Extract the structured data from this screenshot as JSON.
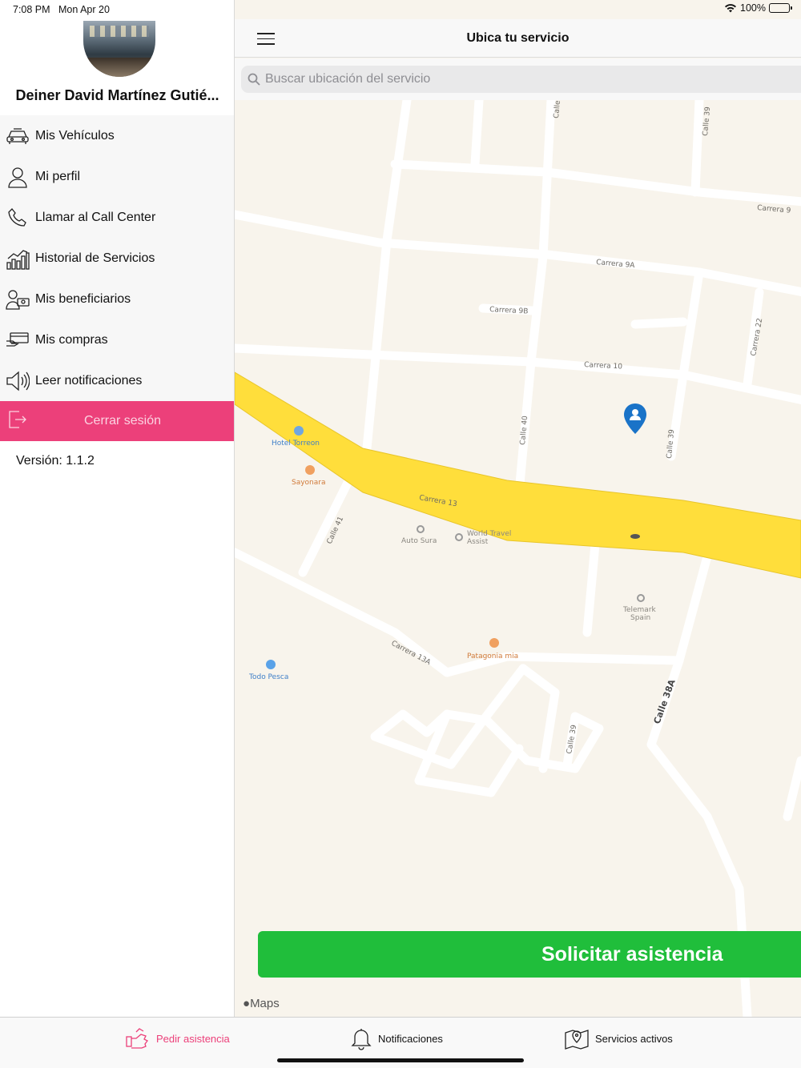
{
  "status_bar": {
    "time": "7:08 PM",
    "date": "Mon Apr 20",
    "battery": "100%"
  },
  "sidebar": {
    "user_name": "Deiner David Martínez Gutié...",
    "items": [
      {
        "label": "Mis Vehículos",
        "icon": "car-icon"
      },
      {
        "label": "Mi perfil",
        "icon": "user-icon"
      },
      {
        "label": "Llamar al Call Center",
        "icon": "phone-icon"
      },
      {
        "label": "Historial de Servicios",
        "icon": "chart-icon"
      },
      {
        "label": "Mis beneficiarios",
        "icon": "beneficiaries-icon"
      },
      {
        "label": "Mis compras",
        "icon": "purchases-icon"
      },
      {
        "label": "Leer notificaciones",
        "icon": "speaker-icon"
      }
    ],
    "logout_label": "Cerrar sesión",
    "version": "Versión: 1.1.2",
    "accent_color": "#ec407a"
  },
  "header": {
    "title": "Ubica tu servicio"
  },
  "search": {
    "placeholder": "Buscar ubicación del servicio"
  },
  "map": {
    "labels": {
      "carrera_9": "Carrera 9",
      "carrera_9a": "Carrera 9A",
      "carrera_9b": "Carrera 9B",
      "carrera_10": "Carrera 10",
      "carrera_13": "Carrera 13",
      "carrera_13a": "Carrera 13A",
      "calle_39_top": "Calle 39",
      "calle_39_mid": "Calle 39",
      "calle_39_bottom": "Calle 39",
      "calle_40": "Calle 40",
      "calle_41": "Calle 41",
      "calle_22": "Carrera 22",
      "calle_38a": "Calle 38A",
      "calle_top": "Calle",
      "hotel_torreon": "Hotel Torreon",
      "sayonara": "Sayonara",
      "auto_sura": "Auto Sura",
      "world_travel_1": "World Travel",
      "world_travel_2": "Assist",
      "telemark_1": "Telemark",
      "telemark_2": "Spain",
      "patagonia": "Patagonia mia",
      "todo_pesca": "Todo Pesca"
    },
    "attribution": "Maps",
    "pin_color": "#1a73c8",
    "highlight_road_color": "#ffde3b"
  },
  "submit_label": "Solicitar asistencia",
  "submit_color": "#20be3b",
  "tabs": [
    {
      "label": "Pedir asistencia",
      "icon": "assistance-icon",
      "active": true
    },
    {
      "label": "Notificaciones",
      "icon": "bell-icon",
      "active": false
    },
    {
      "label": "Servicios activos",
      "icon": "map-pin-icon",
      "active": false
    }
  ]
}
